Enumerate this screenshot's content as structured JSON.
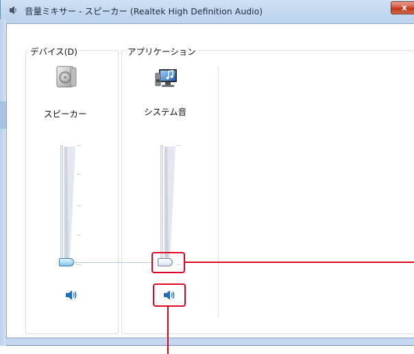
{
  "window": {
    "title": "音量ミキサー - スピーカー (Realtek High Definition Audio)",
    "close_label": "x"
  },
  "device": {
    "group_label": "デバイス(D)",
    "name": "スピーカー",
    "icon": "speaker-device-icon",
    "mute_icon": "speaker-volume-icon"
  },
  "application": {
    "group_label": "アプリケーション",
    "name": "システム音",
    "icon": "system-sounds-icon",
    "mute_icon": "speaker-volume-icon"
  },
  "colors": {
    "callout": "#e0001b",
    "accent": "#1a6fc0"
  }
}
